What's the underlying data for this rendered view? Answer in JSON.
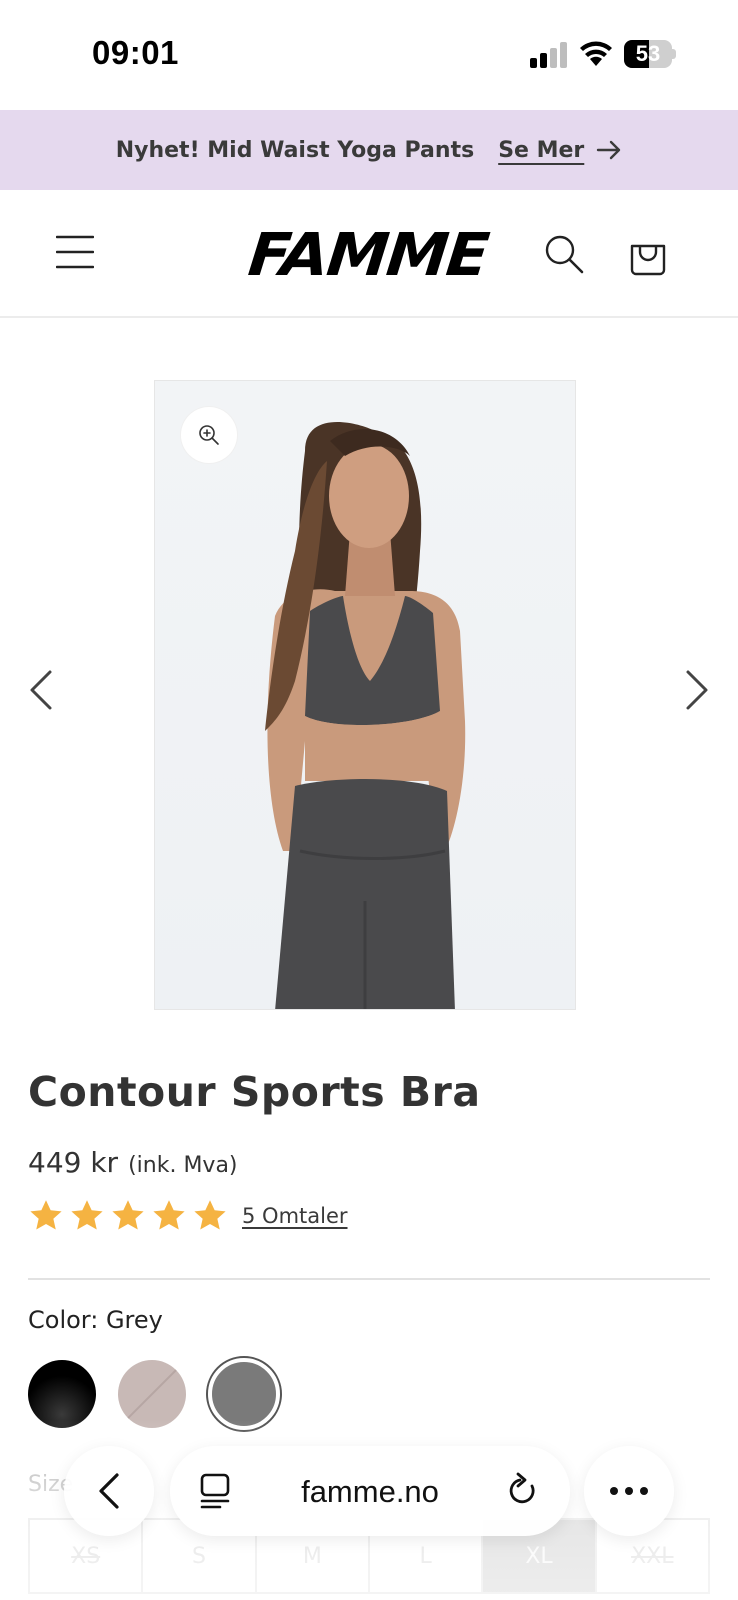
{
  "status_bar": {
    "time": "09:01",
    "battery": "53",
    "battery_level": 0.53
  },
  "announcement": {
    "text": "Nyhet! Mid Waist Yoga Pants",
    "link_label": "Se Mer"
  },
  "header": {
    "logo": "FAMME"
  },
  "product": {
    "title": "Contour Sports Bra",
    "price": "449 kr",
    "price_note": "(ink. Mva)",
    "rating": 5,
    "rating_max": 5,
    "reviews_label": "5 Omtaler",
    "color_label": "Color: Grey",
    "colors": [
      {
        "name": "black",
        "hex": "#000000",
        "selected": false
      },
      {
        "name": "taupe",
        "hex": "#c8b9b6",
        "selected": false,
        "unavailable": true
      },
      {
        "name": "grey",
        "hex": "#7a7a7a",
        "selected": true
      }
    ],
    "size_label": "Size",
    "sizes": [
      {
        "label": "XS",
        "available": false,
        "selected": false
      },
      {
        "label": "S",
        "available": true,
        "selected": false
      },
      {
        "label": "M",
        "available": true,
        "selected": false
      },
      {
        "label": "L",
        "available": true,
        "selected": false
      },
      {
        "label": "XL",
        "available": true,
        "selected": true
      },
      {
        "label": "XXL",
        "available": false,
        "selected": false
      }
    ]
  },
  "browser": {
    "url": "famme.no"
  },
  "colors": {
    "announcement_bg": "#e5d9ee",
    "star": "#f5b342"
  }
}
